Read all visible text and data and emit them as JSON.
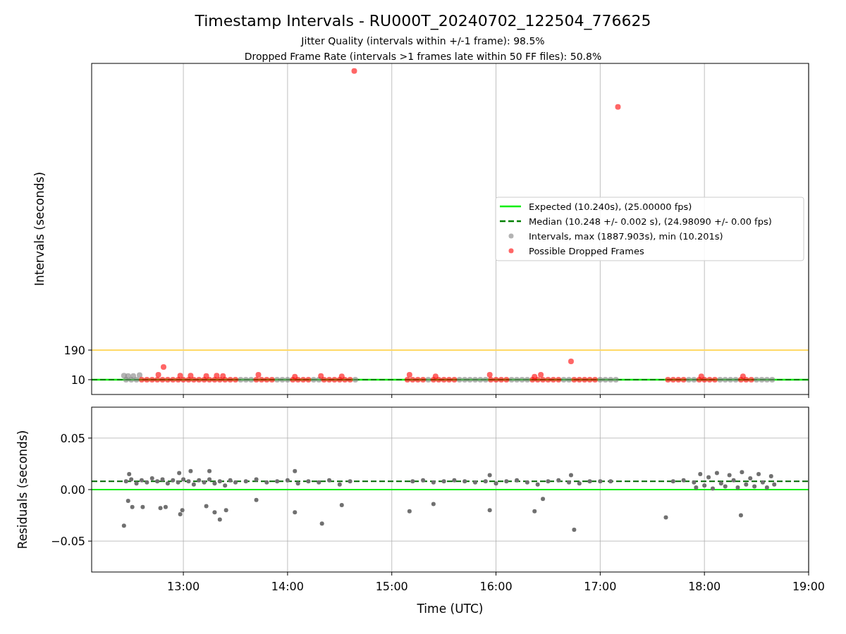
{
  "figure": {
    "title": "Timestamp Intervals - RU000T_20240702_122504_776625",
    "subtitles": [
      "Jitter Quality (intervals within +/-1 frame): 98.5%",
      "Dropped Frame Rate (intervals >1 frames late within 50 FF files): 50.8%"
    ]
  },
  "intervals_plot": {
    "chart_data": {
      "type": "scatter",
      "ylabel": "Intervals (seconds)",
      "xlim": [
        12.12,
        19
      ],
      "ylim": [
        -80,
        1934
      ],
      "yticks": [
        {
          "value": 10,
          "label": "10"
        },
        {
          "value": 190,
          "label": "190"
        }
      ],
      "grid": true,
      "legend": "center right",
      "ref_lines": [
        {
          "axis": "y",
          "value": 10.24,
          "label": "Expected (10.240s), (25.00000 fps)",
          "color": "#00ee00"
        },
        {
          "axis": "y",
          "value": 10.248,
          "label": "Median (10.248 +/- 0.002 s), (24.98090 +/- 0.00 fps)",
          "color": "#008000"
        },
        {
          "axis": "y",
          "value": 190,
          "color": "#ffd966"
        }
      ],
      "x": [
        12.45,
        12.5,
        12.55,
        12.6,
        12.65,
        12.7,
        12.75,
        12.8,
        12.85,
        12.9,
        12.95,
        13.0,
        13.05,
        13.1,
        13.15,
        13.2,
        13.25,
        13.3,
        13.35,
        13.4,
        13.45,
        13.5,
        13.55,
        13.6,
        13.65,
        13.7,
        13.75,
        13.8,
        13.85,
        13.9,
        13.95,
        14.0,
        14.05,
        14.1,
        14.15,
        14.2,
        14.25,
        14.3,
        14.35,
        14.4,
        14.45,
        14.5,
        14.55,
        14.6,
        14.65,
        15.15,
        15.2,
        15.25,
        15.3,
        15.35,
        15.4,
        15.45,
        15.5,
        15.55,
        15.6,
        15.65,
        15.7,
        15.75,
        15.8,
        15.85,
        15.9,
        15.95,
        16.0,
        16.05,
        16.1,
        16.15,
        16.2,
        16.25,
        16.3,
        16.35,
        16.4,
        16.45,
        16.5,
        16.55,
        16.6,
        16.65,
        16.7,
        16.75,
        16.8,
        16.85,
        16.9,
        16.95,
        17.0,
        17.05,
        17.1,
        17.15,
        17.65,
        17.7,
        17.75,
        17.8,
        17.85,
        17.9,
        17.95,
        18.0,
        18.05,
        18.1,
        18.15,
        18.2,
        18.25,
        18.3,
        18.35,
        18.4,
        18.45,
        18.5,
        18.55,
        18.6,
        18.65,
        12.43,
        12.47,
        12.52,
        12.58,
        12.76,
        12.81,
        12.97,
        13.07,
        13.22,
        13.32,
        13.38,
        13.72,
        14.07,
        14.32,
        14.52,
        14.64,
        15.17,
        15.42,
        15.94,
        16.37,
        16.43,
        16.72,
        17.17,
        17.97,
        18.37
      ],
      "series": [
        {
          "name": "Intervals, max (1887.903s), min (10.201s)",
          "color": "#808080",
          "values": [
            10,
            10,
            10,
            null,
            null,
            null,
            null,
            null,
            null,
            null,
            null,
            null,
            null,
            null,
            null,
            null,
            null,
            null,
            null,
            null,
            null,
            null,
            10,
            10,
            10,
            null,
            null,
            null,
            null,
            10,
            10,
            10,
            null,
            null,
            null,
            null,
            10,
            10,
            null,
            null,
            null,
            null,
            null,
            null,
            10,
            null,
            null,
            null,
            null,
            10,
            null,
            null,
            null,
            null,
            null,
            10,
            10,
            10,
            10,
            10,
            10,
            null,
            null,
            null,
            null,
            10,
            10,
            10,
            10,
            null,
            null,
            null,
            null,
            null,
            null,
            10,
            10,
            null,
            null,
            null,
            null,
            null,
            10,
            10,
            10,
            10,
            null,
            null,
            null,
            null,
            10,
            10,
            null,
            null,
            null,
            null,
            10,
            10,
            10,
            10,
            null,
            null,
            null,
            10,
            10,
            10,
            10,
            35,
            33,
            32,
            38,
            null,
            null,
            null,
            null,
            null,
            null,
            null,
            null,
            null,
            null,
            null,
            null,
            null,
            null,
            null,
            null,
            null,
            null,
            null,
            null,
            null
          ]
        },
        {
          "name": "Possible Dropped Frames",
          "color": "#ff0000",
          "values": [
            null,
            null,
            null,
            10,
            10,
            10,
            10,
            10,
            10,
            10,
            10,
            10,
            10,
            10,
            10,
            10,
            10,
            10,
            10,
            10,
            10,
            10,
            null,
            null,
            null,
            10,
            10,
            10,
            10,
            null,
            null,
            null,
            10,
            10,
            10,
            10,
            null,
            null,
            10,
            10,
            10,
            10,
            10,
            10,
            null,
            10,
            10,
            10,
            10,
            null,
            10,
            10,
            10,
            10,
            10,
            null,
            null,
            null,
            null,
            null,
            null,
            10,
            10,
            10,
            10,
            null,
            null,
            null,
            null,
            10,
            10,
            10,
            10,
            10,
            10,
            null,
            null,
            10,
            10,
            10,
            10,
            10,
            null,
            null,
            null,
            null,
            10,
            10,
            10,
            10,
            null,
            null,
            10,
            10,
            10,
            10,
            null,
            null,
            null,
            null,
            10,
            10,
            10,
            null,
            null,
            null,
            null,
            null,
            null,
            null,
            null,
            40,
            87,
            35,
            35,
            32,
            35,
            33,
            40,
            28,
            33,
            30,
            1888,
            40,
            30,
            40,
            28,
            40,
            121,
            1669,
            30,
            30
          ]
        }
      ]
    }
  },
  "residuals_plot": {
    "chart_data": {
      "type": "scatter",
      "xlabel": "Time (UTC)",
      "ylabel": "Residuals (seconds)",
      "xlim": [
        12.12,
        19
      ],
      "ylim": [
        -0.08,
        0.08
      ],
      "xticks": [
        {
          "value": 13,
          "label": "13:00"
        },
        {
          "value": 14,
          "label": "14:00"
        },
        {
          "value": 15,
          "label": "15:00"
        },
        {
          "value": 16,
          "label": "16:00"
        },
        {
          "value": 17,
          "label": "17:00"
        },
        {
          "value": 18,
          "label": "18:00"
        },
        {
          "value": 19,
          "label": "19:00"
        }
      ],
      "yticks": [
        {
          "value": 0.05,
          "label": "0.05"
        },
        {
          "value": 0,
          "label": "0.00"
        },
        {
          "value": -0.05,
          "label": "−0.05"
        }
      ],
      "grid": true,
      "ref_lines": [
        {
          "axis": "y",
          "value": 0,
          "color": "#00ee00"
        },
        {
          "axis": "y",
          "value": 0.008,
          "color": "#006400"
        }
      ],
      "x": [
        12.45,
        12.5,
        12.55,
        12.6,
        12.65,
        12.7,
        12.75,
        12.8,
        12.85,
        12.9,
        12.95,
        13.0,
        13.05,
        13.1,
        13.15,
        13.2,
        13.25,
        13.3,
        13.35,
        13.4,
        13.45,
        13.5,
        13.6,
        13.7,
        13.8,
        13.9,
        14.0,
        14.1,
        14.2,
        14.3,
        14.4,
        14.5,
        14.6,
        15.2,
        15.3,
        15.4,
        15.5,
        15.6,
        15.7,
        15.8,
        15.9,
        16.0,
        16.1,
        16.2,
        16.3,
        16.4,
        16.5,
        16.6,
        16.7,
        16.8,
        16.9,
        17.0,
        17.1,
        17.7,
        17.8,
        17.9,
        17.92,
        17.96,
        18.0,
        18.04,
        18.08,
        18.12,
        18.16,
        18.2,
        18.24,
        18.28,
        18.32,
        18.36,
        18.4,
        18.44,
        18.48,
        18.52,
        18.56,
        18.6,
        18.64,
        18.67,
        12.43,
        12.47,
        12.51,
        12.61,
        12.78,
        12.83,
        12.97,
        12.99,
        13.22,
        13.3,
        13.35,
        13.41,
        13.7,
        14.07,
        14.33,
        14.52,
        15.17,
        15.4,
        15.94,
        16.37,
        16.45,
        16.75,
        17.63,
        18.35,
        12.48,
        12.96,
        13.07,
        13.25,
        14.07,
        16.72,
        15.94
      ],
      "series": [
        {
          "color": "#707070",
          "values": [
            0.008,
            0.01,
            0.006,
            0.009,
            0.007,
            0.011,
            0.008,
            0.01,
            0.006,
            0.009,
            0.007,
            0.01,
            0.008,
            0.005,
            0.009,
            0.007,
            0.01,
            0.006,
            0.008,
            0.004,
            0.009,
            0.007,
            0.008,
            0.01,
            0.007,
            0.008,
            0.009,
            0.006,
            0.008,
            0.007,
            0.009,
            0.005,
            0.008,
            0.008,
            0.009,
            0.007,
            0.008,
            0.009,
            0.008,
            0.007,
            0.008,
            0.006,
            0.008,
            0.009,
            0.007,
            0.005,
            0.008,
            0.009,
            0.007,
            0.006,
            0.008,
            0.008,
            0.008,
            0.008,
            0.009,
            0.007,
            0.002,
            0.015,
            0.004,
            0.012,
            0.001,
            0.016,
            0.006,
            0.003,
            0.014,
            0.009,
            0.002,
            0.017,
            0.005,
            0.011,
            0.003,
            0.015,
            0.007,
            0.002,
            0.013,
            0.005,
            -0.035,
            -0.011,
            -0.017,
            -0.017,
            -0.018,
            -0.017,
            -0.024,
            -0.02,
            -0.016,
            -0.022,
            -0.029,
            -0.02,
            -0.01,
            -0.022,
            -0.033,
            -0.015,
            -0.021,
            -0.014,
            -0.02,
            -0.021,
            -0.009,
            -0.039,
            -0.027,
            -0.025,
            0.015,
            0.016,
            0.018,
            0.018,
            0.018,
            0.014,
            0.014
          ]
        }
      ]
    }
  }
}
